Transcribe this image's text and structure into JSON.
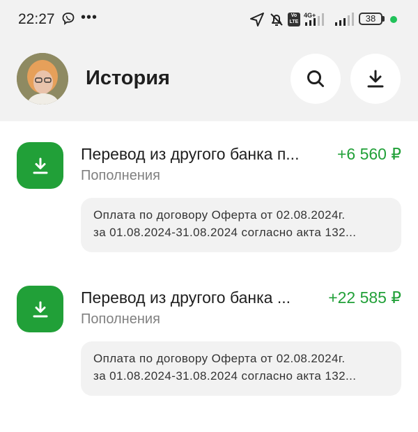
{
  "status_bar": {
    "time": "22:27",
    "dots": "•••",
    "network_label": "4G+",
    "volte_label": "Vo LTE",
    "battery": "38"
  },
  "header": {
    "title": "История",
    "search_icon": "search-icon",
    "download_icon": "download-icon"
  },
  "colors": {
    "accent_green": "#21a038",
    "header_bg": "#f2f2f2"
  },
  "transactions": [
    {
      "title": "Перевод из другого банка п...",
      "amount": "+6 560 ₽",
      "category": "Пополнения",
      "note_line1": "Оплата по договору Оферта от 02.08.2024г.",
      "note_line2": "за 01.08.2024-31.08.2024 согласно акта 132..."
    },
    {
      "title": "Перевод из другого банка ...",
      "amount": "+22 585 ₽",
      "category": "Пополнения",
      "note_line1": "Оплата по договору Оферта от 02.08.2024г.",
      "note_line2": "за 01.08.2024-31.08.2024 согласно акта 132..."
    }
  ]
}
